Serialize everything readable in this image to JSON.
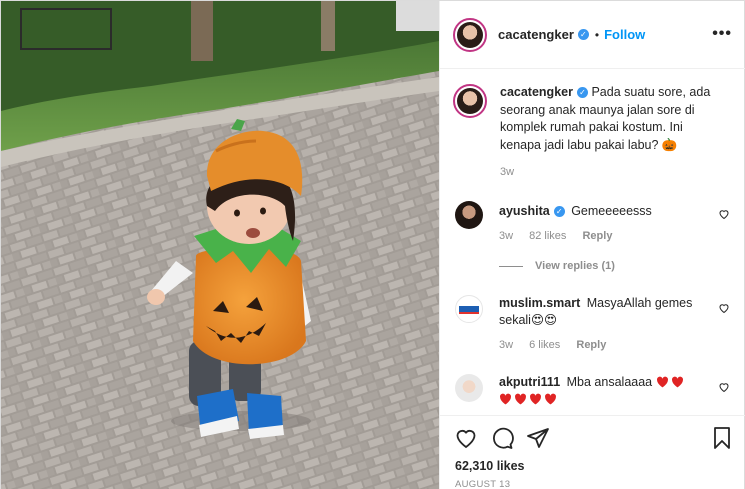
{
  "post": {
    "username": "cacatengker",
    "follow_label": "Follow",
    "dot": "•",
    "more_label": "•••"
  },
  "caption": {
    "username": "cacatengker",
    "text": "Pada suatu sore, ada seorang anak maunya jalan sore di komplek rumah pakai kostum. Ini kenapa jadi labu pakai labu? 🎃",
    "time": "3w"
  },
  "comments": [
    {
      "username": "ayushita",
      "verified": true,
      "text": "Gemeeeeesss",
      "time": "3w",
      "likes": "82 likes",
      "reply": "Reply"
    },
    {
      "username": "muslim.smart",
      "verified": false,
      "text": "MasyaAllah gemes sekali😍😍",
      "time": "3w",
      "likes": "6 likes",
      "reply": "Reply"
    },
    {
      "username": "akputri111",
      "verified": false,
      "text": "Mba ansalaaaa"
    }
  ],
  "view_replies": "View replies (1)",
  "likes_count": "62,310 likes",
  "date": "AUGUST 13",
  "colors": {
    "link": "#0095f6",
    "verified": "#3897f0",
    "heart": "#ed4956",
    "muted": "#8e8e8e"
  },
  "icons": [
    "heart-icon",
    "comment-icon",
    "share-icon",
    "bookmark-icon",
    "verified-icon",
    "more-options-icon"
  ]
}
